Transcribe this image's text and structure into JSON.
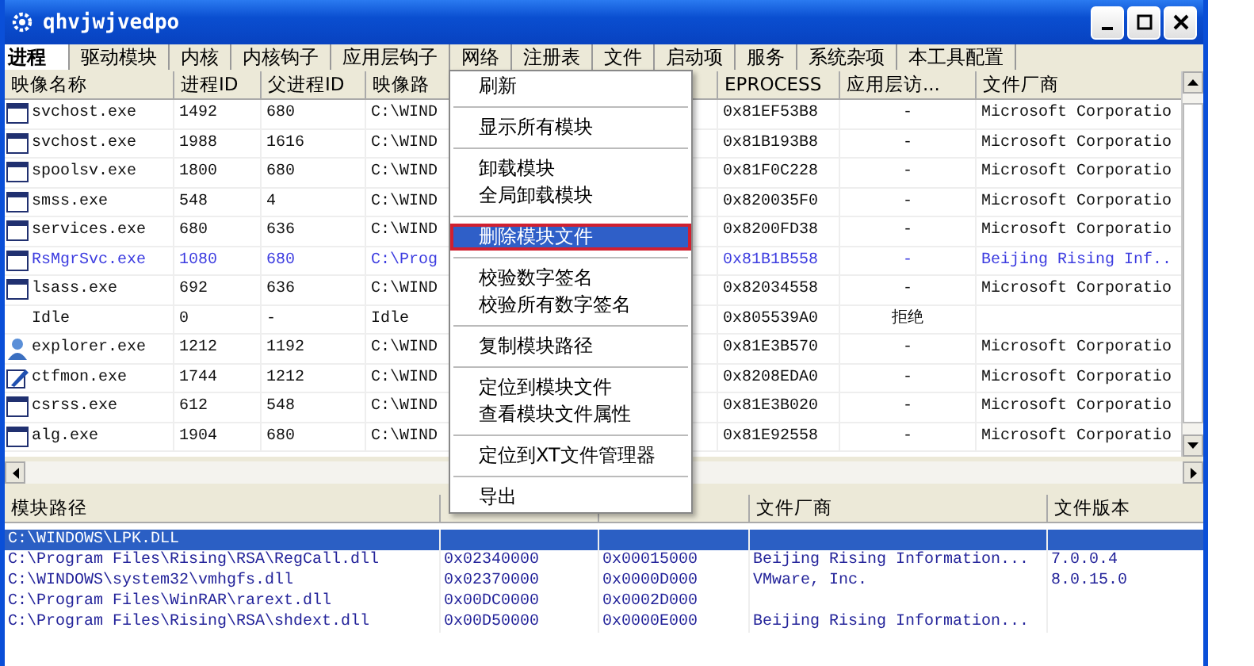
{
  "window": {
    "title": "qhvjwjvedpo"
  },
  "tabs": [
    {
      "label": "进程",
      "selected": true
    },
    {
      "label": "驱动模块",
      "selected": false
    },
    {
      "label": "内核",
      "selected": false
    },
    {
      "label": "内核钩子",
      "selected": false
    },
    {
      "label": "应用层钩子",
      "selected": false
    },
    {
      "label": "网络",
      "selected": false
    },
    {
      "label": "注册表",
      "selected": false
    },
    {
      "label": "文件",
      "selected": false
    },
    {
      "label": "启动项",
      "selected": false
    },
    {
      "label": "服务",
      "selected": false
    },
    {
      "label": "系统杂项",
      "selected": false
    },
    {
      "label": "本工具配置",
      "selected": false
    }
  ],
  "process_table": {
    "columns": [
      "映像名称",
      "进程ID",
      "父进程ID",
      "映像路",
      "EPROCESS",
      "应用层访...",
      "文件厂商"
    ],
    "rows": [
      {
        "kind": "window",
        "marked": false,
        "cells": [
          "svchost.exe",
          "1492",
          "680",
          "C:\\WIND",
          "0x81EF53B8",
          "-",
          "Microsoft Corporatio"
        ]
      },
      {
        "kind": "window",
        "marked": false,
        "cells": [
          "svchost.exe",
          "1988",
          "1616",
          "C:\\WIND",
          "0x81B193B8",
          "-",
          "Microsoft Corporatio"
        ]
      },
      {
        "kind": "window",
        "marked": false,
        "cells": [
          "spoolsv.exe",
          "1800",
          "680",
          "C:\\WIND",
          "0x81F0C228",
          "-",
          "Microsoft Corporatio"
        ]
      },
      {
        "kind": "window",
        "marked": false,
        "cells": [
          "smss.exe",
          "548",
          "4",
          "C:\\WIND",
          "0x820035F0",
          "-",
          "Microsoft Corporatio"
        ]
      },
      {
        "kind": "window",
        "marked": false,
        "cells": [
          "services.exe",
          "680",
          "636",
          "C:\\WIND",
          "0x8200FD38",
          "-",
          "Microsoft Corporatio"
        ]
      },
      {
        "kind": "window",
        "marked": true,
        "cells": [
          "RsMgrSvc.exe",
          "1080",
          "680",
          "C:\\Prog",
          "0x81B1B558",
          "-",
          "Beijing Rising Inf.."
        ]
      },
      {
        "kind": "window",
        "marked": false,
        "cells": [
          "lsass.exe",
          "692",
          "636",
          "C:\\WIND",
          "0x82034558",
          "-",
          "Microsoft Corporatio"
        ]
      },
      {
        "kind": "plain",
        "marked": false,
        "cells": [
          "Idle",
          "0",
          "-",
          "Idle",
          "0x805539A0",
          "拒绝",
          ""
        ]
      },
      {
        "kind": "user",
        "marked": false,
        "cells": [
          "explorer.exe",
          "1212",
          "1192",
          "C:\\WIND",
          "0x81E3B570",
          "-",
          "Microsoft Corporatio"
        ]
      },
      {
        "kind": "editor",
        "marked": false,
        "cells": [
          "ctfmon.exe",
          "1744",
          "1212",
          "C:\\WIND",
          "0x8208EDA0",
          "-",
          "Microsoft Corporatio"
        ]
      },
      {
        "kind": "window",
        "marked": false,
        "cells": [
          "csrss.exe",
          "612",
          "548",
          "C:\\WIND",
          "0x81E3B020",
          "-",
          "Microsoft Corporatio"
        ]
      },
      {
        "kind": "window",
        "marked": false,
        "cells": [
          "alg.exe",
          "1904",
          "680",
          "C:\\WIND",
          "0x81E92558",
          "-",
          "Microsoft Corporatio"
        ]
      }
    ]
  },
  "module_table": {
    "columns": [
      "模块路径",
      "",
      "",
      "文件厂商",
      "文件版本"
    ],
    "rows": [
      {
        "selected": true,
        "cells": [
          "C:\\WINDOWS\\LPK.DLL",
          "",
          "",
          "",
          ""
        ]
      },
      {
        "selected": false,
        "cells": [
          "C:\\Program Files\\Rising\\RSA\\RegCall.dll",
          "0x02340000",
          "0x00015000",
          "Beijing Rising Information...",
          "7.0.0.4"
        ]
      },
      {
        "selected": false,
        "cells": [
          "C:\\WINDOWS\\system32\\vmhgfs.dll",
          "0x02370000",
          "0x0000D000",
          "VMware, Inc.",
          "8.0.15.0"
        ]
      },
      {
        "selected": false,
        "cells": [
          "C:\\Program Files\\WinRAR\\rarext.dll",
          "0x00DC0000",
          "0x0002D000",
          "",
          ""
        ]
      },
      {
        "selected": false,
        "cells": [
          "C:\\Program Files\\Rising\\RSA\\shdext.dll",
          "0x00D50000",
          "0x0000E000",
          "Beijing Rising Information...",
          ""
        ]
      }
    ]
  },
  "context_menu": {
    "groups": [
      [
        {
          "label": "刷新",
          "selected": false
        }
      ],
      [
        {
          "label": "显示所有模块",
          "selected": false
        }
      ],
      [
        {
          "label": "卸载模块",
          "selected": false
        },
        {
          "label": "全局卸载模块",
          "selected": false
        }
      ],
      [
        {
          "label": "删除模块文件",
          "selected": true
        }
      ],
      [
        {
          "label": "校验数字签名",
          "selected": false
        },
        {
          "label": "校验所有数字签名",
          "selected": false
        }
      ],
      [
        {
          "label": "复制模块路径",
          "selected": false
        }
      ],
      [
        {
          "label": "定位到模块文件",
          "selected": false
        },
        {
          "label": "查看模块文件属性",
          "selected": false
        }
      ],
      [
        {
          "label": "定位到XT文件管理器",
          "selected": false
        }
      ],
      [
        {
          "label": "导出",
          "selected": false
        }
      ]
    ]
  }
}
